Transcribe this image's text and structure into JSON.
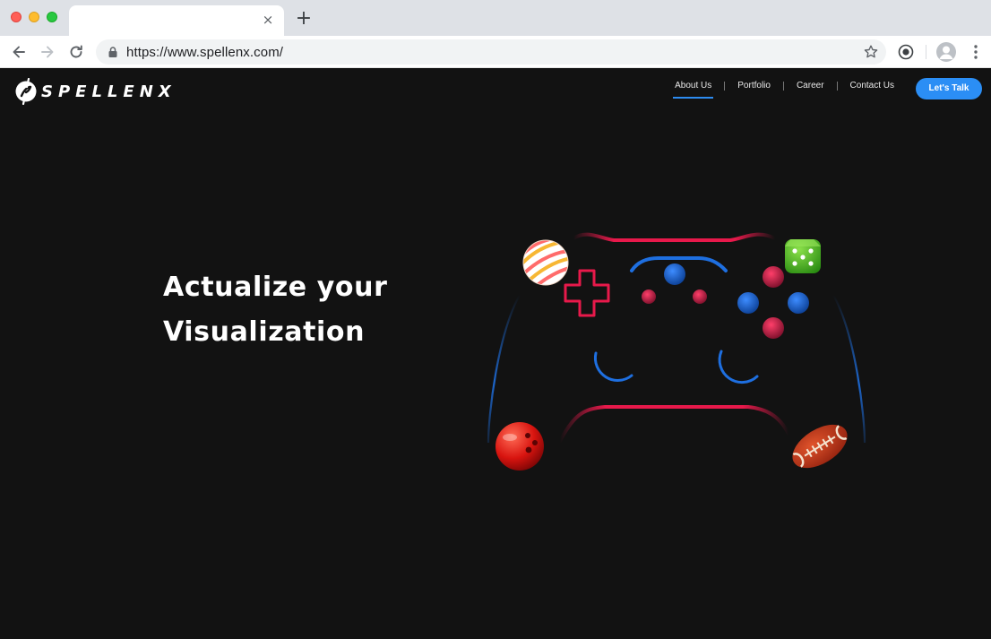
{
  "browser": {
    "url": "https://www.spellenx.com/",
    "tab_close_glyph": "×",
    "new_tab_glyph": "+"
  },
  "site": {
    "logo_text": "SPELLENX",
    "nav": [
      {
        "label": "About Us",
        "active": true
      },
      {
        "label": "Portfolio",
        "active": false
      },
      {
        "label": "Career",
        "active": false
      },
      {
        "label": "Contact Us",
        "active": false
      }
    ],
    "cta_label": "Let's Talk",
    "hero": {
      "line1": "Actualize your",
      "line2": "Visualization"
    }
  },
  "icons": {
    "back": "back-arrow-icon",
    "forward": "forward-arrow-icon",
    "reload": "reload-icon",
    "lock": "lock-icon",
    "bookmark": "star-icon",
    "extension": "extension-icon",
    "profile": "profile-icon",
    "menu": "kebab-menu-icon"
  },
  "colors": {
    "accent_blue": "#2b8ef5",
    "neon_red": "#e8194b",
    "neon_blue": "#1e6fe0",
    "page_bg": "#121212"
  }
}
